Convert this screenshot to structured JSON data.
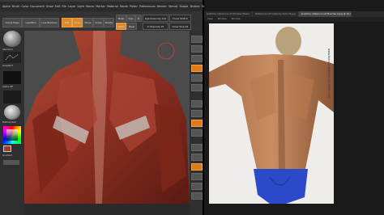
{
  "zbrush": {
    "menu": [
      "Alpha",
      "Brush",
      "Color",
      "Document",
      "Draw",
      "Edit",
      "File",
      "Layer",
      "Light",
      "Macro",
      "Marker",
      "Material",
      "Movie",
      "Picker",
      "Preferences",
      "Render",
      "Stencil",
      "Stroke",
      "Texture",
      "Tool",
      "Transform",
      "Zplugin",
      "Zscript"
    ],
    "toolbar": {
      "home_page": "Home Page",
      "lightbox": "LightBox",
      "live_boolean": "Live Boolean",
      "edit": "Edit",
      "draw": "Draw",
      "move": "Move",
      "scale": "Scale",
      "rotate": "Rotate",
      "mrgb": "Mrgb",
      "rgb": "Rgb",
      "m": "M",
      "zadd": "Zadd",
      "zsub": "Zsub",
      "rgb_intensity": "Rgb Intensity 100",
      "z_intensity": "Z Intensity 25",
      "focal_shift": "Focal Shift 0",
      "draw_size": "Draw Size 64"
    },
    "left_shelf": {
      "brush_label": "Standard",
      "stroke_label": "DragRect",
      "alpha_label": "Alpha Off",
      "material_label": "MatCap Red",
      "color_label": "Gradient"
    },
    "colors": {
      "accent": "#e07b1a",
      "menubar": "#2b2b2b",
      "canvas": "#4b4b4b",
      "muscle": "#9e3b2b"
    }
  },
  "viewer": {
    "tabs": [
      "anatomy reference ref Muscles (Back)",
      "Reference ref Anatomy back 01.jpg",
      "anatomy reference ref Muscles 2.jpg @ 16.7% (RGB/8)"
    ],
    "subbar": [
      "View",
      "Window",
      "Window"
    ],
    "watermark": "www.human-anatomy-for-artist.com"
  }
}
